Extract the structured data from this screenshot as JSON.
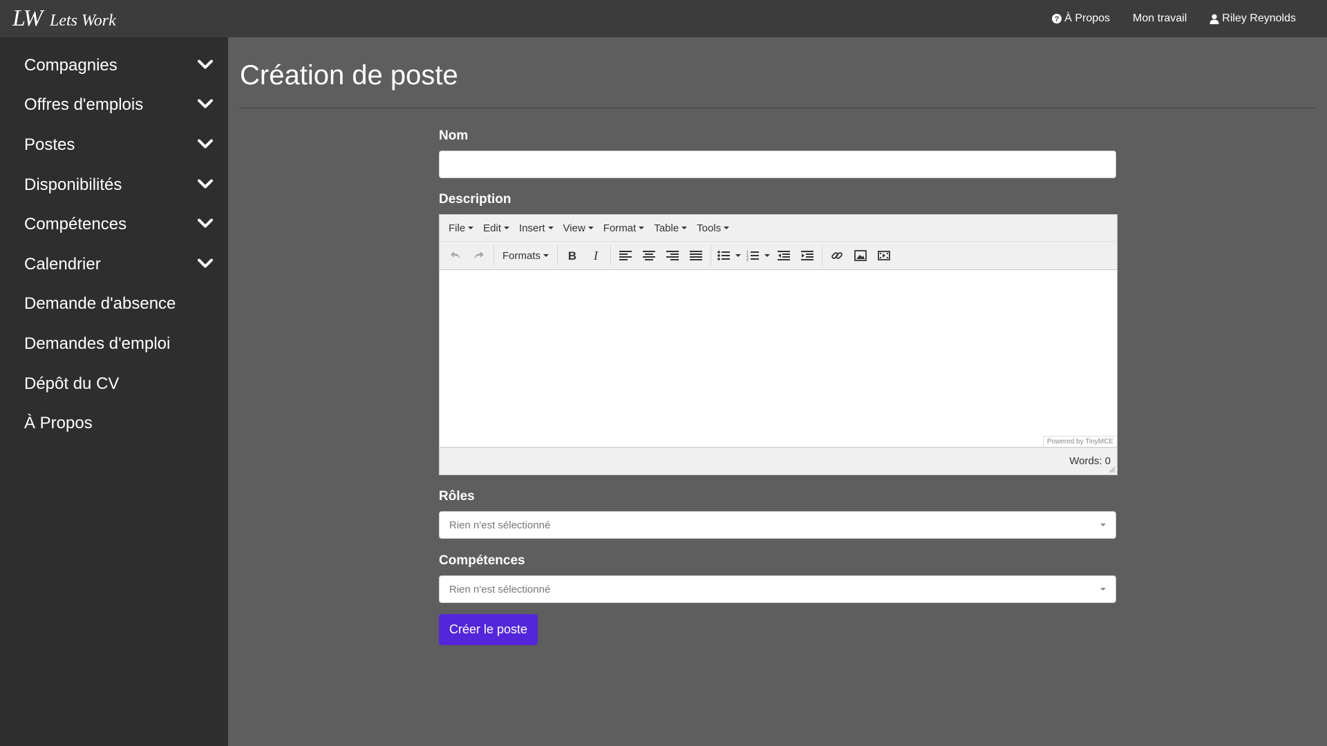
{
  "navbar": {
    "logo": "LW",
    "brand": "Lets Work",
    "links": [
      {
        "label": "À Propos",
        "icon": "question-circle-icon"
      },
      {
        "label": "Mon travail"
      },
      {
        "label": "Riley Reynolds",
        "icon": "user-icon"
      }
    ]
  },
  "sidebar": {
    "items": [
      {
        "label": "Compagnies",
        "expandable": true
      },
      {
        "label": "Offres d'emplois",
        "expandable": true
      },
      {
        "label": "Postes",
        "expandable": true
      },
      {
        "label": "Disponibilités",
        "expandable": true
      },
      {
        "label": "Compétences",
        "expandable": true
      },
      {
        "label": "Calendrier",
        "expandable": true
      },
      {
        "label": "Demande d'absence",
        "expandable": false
      },
      {
        "label": "Demandes d'emploi",
        "expandable": false
      },
      {
        "label": "Dépôt du CV",
        "expandable": false
      },
      {
        "label": "À Propos",
        "expandable": false
      }
    ]
  },
  "main": {
    "title": "Création de poste",
    "form": {
      "name_label": "Nom",
      "name_value": "",
      "description_label": "Description",
      "editor": {
        "menus": [
          "File",
          "Edit",
          "Insert",
          "View",
          "Format",
          "Table",
          "Tools"
        ],
        "formats_label": "Formats",
        "powered_by": "Powered by TinyMCE",
        "word_count": "Words: 0"
      },
      "roles_label": "Rôles",
      "roles_placeholder": "Rien n'est sélectionné",
      "skills_label": "Compétences",
      "skills_placeholder": "Rien n'est sélectionné",
      "submit_label": "Créer le poste"
    }
  },
  "colors": {
    "navbar_bg": "#3c3c3c",
    "sidebar_bg": "#2e2e2e",
    "main_bg": "#5e5e5e",
    "primary_button": "#5326d9"
  }
}
